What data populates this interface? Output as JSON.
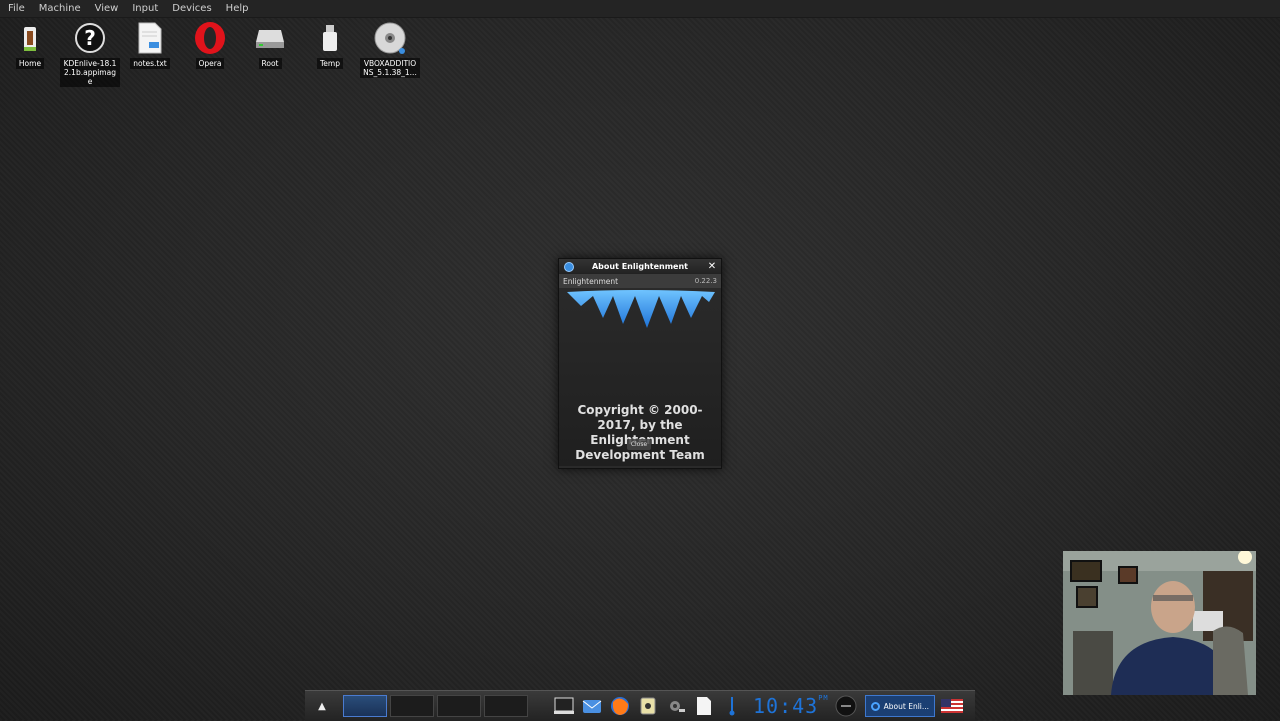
{
  "menubar": {
    "items": [
      "File",
      "Machine",
      "View",
      "Input",
      "Devices",
      "Help"
    ]
  },
  "desktop_icons": [
    {
      "label": "Home",
      "icon": "home-folder-icon"
    },
    {
      "label": "KDEnlive-18.1\n2.1b.appimage",
      "icon": "question-mark-icon"
    },
    {
      "label": "notes.txt",
      "icon": "text-file-icon"
    },
    {
      "label": "Opera",
      "icon": "opera-icon"
    },
    {
      "label": "Root",
      "icon": "drive-icon"
    },
    {
      "label": "Temp",
      "icon": "usb-drive-icon"
    },
    {
      "label": "VBOXADDITIO\nNS_5.1.38_1...",
      "icon": "cdrom-icon"
    }
  ],
  "dialog": {
    "title": "About Enlightenment",
    "app_name": "Enlightenment",
    "version": "0.22.3",
    "copyright": "Copyright © 2000-2017, by the Enlightenment Development Team",
    "close_label": "Close"
  },
  "shelf": {
    "clock_time": "10:43",
    "clock_ampm": "PM",
    "task_label": "About Enli..."
  },
  "colors": {
    "accent": "#1e73d8",
    "desktop_bg": "#2a2a2a"
  }
}
